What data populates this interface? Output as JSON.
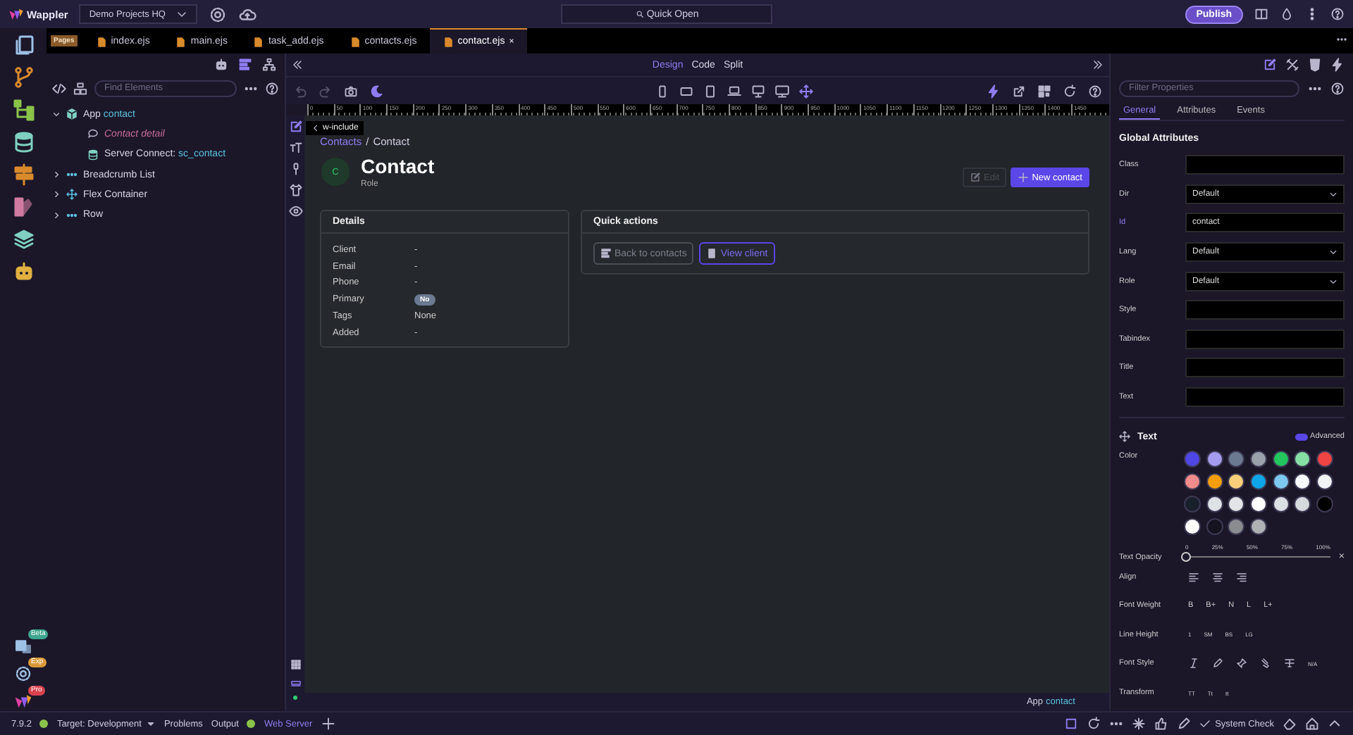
{
  "top_bar": {
    "app_name": "Wappler",
    "project": "Demo Projects HQ",
    "quick_open": "Quick Open",
    "publish": "Publish"
  },
  "file_tabs": {
    "group_label": "Pages",
    "tabs": [
      {
        "label": "index.ejs",
        "selected": false
      },
      {
        "label": "main.ejs",
        "selected": false
      },
      {
        "label": "task_add.ejs",
        "selected": false
      },
      {
        "label": "contacts.ejs",
        "selected": false
      },
      {
        "label": "contact.ejs",
        "selected": true,
        "close": "×"
      }
    ]
  },
  "activity_bar": {
    "badges": [
      {
        "label": "Beta",
        "color": "#3fa58f"
      },
      {
        "label": "Exp",
        "color": "#d99a3a"
      },
      {
        "label": "Pro",
        "color": "#d8434f"
      }
    ]
  },
  "left_panel": {
    "search_placeholder": "Find Elements",
    "tree": [
      {
        "kind": "app",
        "label": "App",
        "detail": "contact",
        "expanded": true,
        "children": [
          {
            "kind": "comment",
            "label": "Contact detail"
          },
          {
            "kind": "server",
            "label": "Server Connect:",
            "detail": "sc_contact"
          }
        ]
      },
      {
        "kind": "dots",
        "label": "Breadcrumb List",
        "expanded": false
      },
      {
        "kind": "flex",
        "label": "Flex Container",
        "expanded": false
      },
      {
        "kind": "dots",
        "label": "Row",
        "expanded": false
      }
    ]
  },
  "view_modes": [
    {
      "label": "Design",
      "selected": true
    },
    {
      "label": "Code",
      "selected": false
    },
    {
      "label": "Split",
      "selected": false
    }
  ],
  "ruler_labels": [
    "0",
    "50",
    "100",
    "150",
    "200",
    "250",
    "300",
    "350",
    "400",
    "450",
    "500",
    "550",
    "600",
    "650",
    "700",
    "750",
    "800",
    "850",
    "900",
    "950",
    "1000",
    "1050",
    "1100",
    "1150",
    "1200",
    "1250",
    "1300",
    "1350",
    "1400",
    "1450"
  ],
  "canvas": {
    "tooltip": "w-include",
    "breadcrumb": {
      "link": "Contacts",
      "separator": "/",
      "current": "Contact"
    },
    "avatar": "C",
    "title": "Contact",
    "subtitle": "Role",
    "buttons": [
      {
        "kind": "edit",
        "label": "Edit",
        "disabled": true
      },
      {
        "kind": "primary",
        "label": "New contact",
        "disabled": false
      }
    ],
    "details": {
      "title": "Details",
      "rows": [
        {
          "label": "Client",
          "value": "-",
          "kind": "text"
        },
        {
          "label": "Email",
          "value": "-",
          "kind": "text"
        },
        {
          "label": "Phone",
          "value": "-",
          "kind": "text"
        },
        {
          "label": "Primary",
          "value": "No",
          "kind": "badge"
        },
        {
          "label": "Tags",
          "value": "None",
          "kind": "text"
        },
        {
          "label": "Added",
          "value": "-",
          "kind": "text"
        }
      ]
    },
    "quick_actions": {
      "title": "Quick actions",
      "buttons": [
        {
          "kind": "list",
          "label": "Back to contacts"
        },
        {
          "kind": "client",
          "label": "View client"
        }
      ]
    },
    "status": {
      "label": "App",
      "detail": "contact"
    }
  },
  "properties": {
    "filter_placeholder": "Filter Properties",
    "tabs": [
      {
        "label": "General",
        "selected": true
      },
      {
        "label": "Attributes",
        "selected": false
      },
      {
        "label": "Events",
        "selected": false
      }
    ],
    "section_title": "Global Attributes",
    "fields": [
      {
        "label": "Class",
        "kind": "text",
        "highlighted": false
      },
      {
        "label": "Dir",
        "kind": "select",
        "value": "Default",
        "highlighted": false
      },
      {
        "label": "Id",
        "kind": "text",
        "value": "contact",
        "highlighted": true
      },
      {
        "label": "Lang",
        "kind": "select",
        "value": "Default",
        "highlighted": false
      },
      {
        "label": "Role",
        "kind": "select",
        "value": "Default",
        "highlighted": false
      },
      {
        "label": "Style",
        "kind": "text",
        "highlighted": false
      },
      {
        "label": "Tabindex",
        "kind": "text",
        "highlighted": false
      },
      {
        "label": "Title",
        "kind": "text",
        "highlighted": false
      },
      {
        "label": "Text",
        "kind": "text",
        "highlighted": false
      }
    ],
    "text": {
      "title": "Text",
      "advanced": {
        "label": "Advanced",
        "on": true
      },
      "color_label": "Color",
      "colors": [
        {
          "color": "#4f46e5"
        },
        {
          "color": "#a59cf0"
        },
        {
          "color": "#6b7a90"
        },
        {
          "color": "#9aa1aa"
        },
        {
          "color": "#22c55e"
        },
        {
          "color": "#86e0a4"
        },
        {
          "color": "#ef4444"
        },
        {
          "color": "#f28b8b"
        },
        {
          "color": "#f59e0b"
        },
        {
          "color": "#fcd07a"
        },
        {
          "color": "#0ea5e9"
        },
        {
          "color": "#7cc8ee"
        },
        {
          "color": "#f8f9fa"
        },
        {
          "color": "#f1f3f5"
        },
        {
          "color": "#1a1f2e"
        },
        {
          "color": "#dee2e6"
        },
        {
          "color": "#e2e4e8"
        },
        {
          "color": "#ffffff"
        },
        {
          "color": "#dcdfe3"
        },
        {
          "color": "#d6d9dd"
        },
        {
          "color": "#000000"
        },
        {
          "color": "#ffffff"
        },
        {
          "color": "#15131f"
        },
        {
          "color": "#8a8c90"
        },
        {
          "color": "#aeb0b4"
        }
      ],
      "opacity": {
        "label": "Text Opacity",
        "ticks": [
          "0",
          "25%",
          "50%",
          "75%",
          "100%"
        ],
        "level": 0,
        "clear": "×"
      },
      "align_label": "Align",
      "font_weight": {
        "label": "Font Weight",
        "options": [
          "B",
          "B+",
          "N",
          "L",
          "L+"
        ]
      },
      "line_height": {
        "label": "Line Height",
        "options": [
          "1",
          "SM",
          "BS",
          "LG"
        ]
      },
      "font_style": {
        "label": "Font Style",
        "text_option": "N/A"
      },
      "transform": {
        "label": "Transform",
        "options": [
          "TT",
          "Tt",
          "tt"
        ]
      }
    }
  },
  "status_bar": {
    "version": "7.9.2",
    "target": "Target: Development",
    "problems": "Problems",
    "output": "Output",
    "web_server": "Web Server",
    "system_check": "System Check"
  }
}
